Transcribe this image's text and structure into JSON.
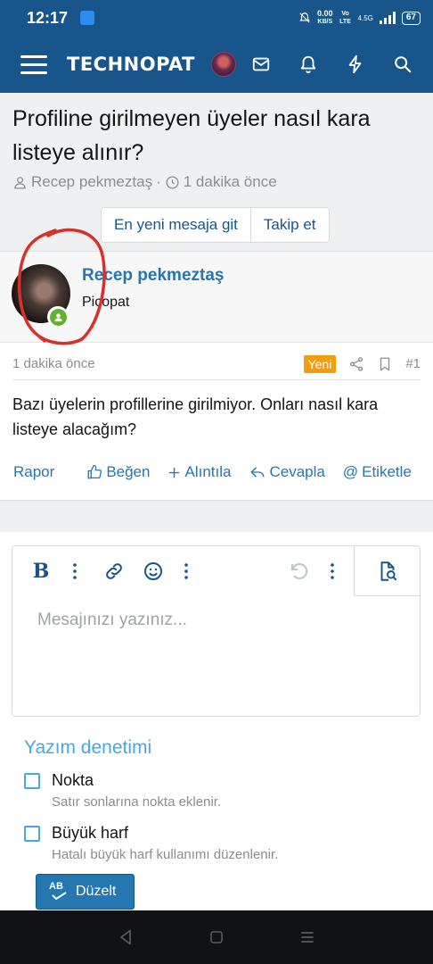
{
  "status_bar": {
    "time": "12:17",
    "net_speed": "0.00",
    "net_unit": "KB/S",
    "net_type": "Vo LTE",
    "signal_label": "4.5G",
    "battery": "67"
  },
  "header": {
    "logo": "TECHNOPAT",
    "icons": [
      "menu-icon",
      "avatar",
      "mail-icon",
      "bell-icon",
      "bolt-icon",
      "search-icon"
    ]
  },
  "thread": {
    "title": "Profiline girilmeyen üyeler nasıl kara listeye alınır?",
    "author": "Recep pekmeztaş",
    "separator": "·",
    "time": "1 dakika önce",
    "buttons": {
      "go_latest": "En yeni mesaja git",
      "follow": "Takip et"
    }
  },
  "post": {
    "username": "Recep pekmeztaş",
    "user_title": "Picopat",
    "date": "1 dakika önce",
    "new_badge": "Yeni",
    "number": "#1",
    "body": "Bazı üyelerin profillerine girilmiyor. Onları nasıl kara listeye alacağım?",
    "actions": {
      "report": "Rapor",
      "like": "Beğen",
      "quote": "Alıntıla",
      "reply": "Cevapla",
      "tag": "Etiketle"
    }
  },
  "editor": {
    "placeholder": "Mesajınızı yazınız..."
  },
  "spellcheck": {
    "title": "Yazım denetimi",
    "options": [
      {
        "label": "Nokta",
        "description": "Satır sonlarına nokta eklenir."
      },
      {
        "label": "Büyük harf",
        "description": "Hatalı büyük harf kullanımı düzenlenir."
      }
    ],
    "fix_button": "Düzelt",
    "fix_icon_text": "AB"
  },
  "colors": {
    "brand": "#18558a",
    "link": "#2577b1",
    "accent": "#47a7eb",
    "new_badge": "#f39c12",
    "online": "#63b132",
    "annotation": "#d9302a"
  }
}
